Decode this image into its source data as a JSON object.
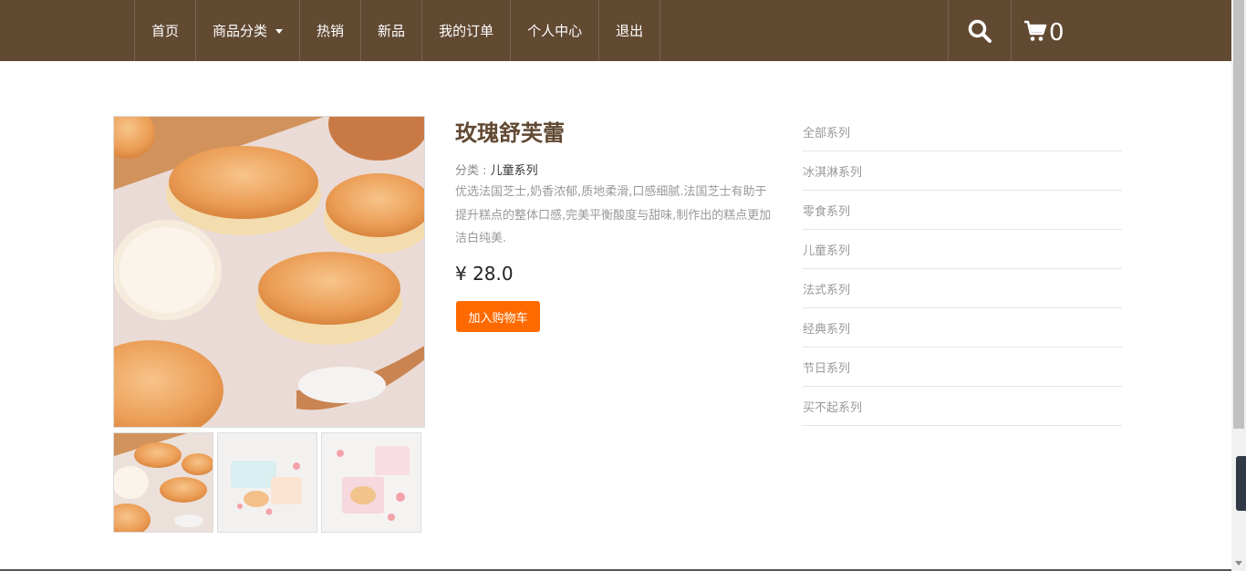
{
  "nav": {
    "items": [
      {
        "label": "首页"
      },
      {
        "label": "商品分类"
      },
      {
        "label": "热销"
      },
      {
        "label": "新品"
      },
      {
        "label": "我的订单"
      },
      {
        "label": "个人中心"
      },
      {
        "label": "退出"
      }
    ],
    "search_icon": "search-icon",
    "cart_icon": "cart-icon",
    "cart_count": "0"
  },
  "product": {
    "title": "玫瑰舒芙蕾",
    "category_label": "分类 : ",
    "category_value": "儿童系列",
    "description": "优选法国芝士,奶香浓郁,质地柔滑,口感细腻.法国芝士有助于提升糕点的整体口感,完美平衡酸度与甜味,制作出的糕点更加洁白纯美.",
    "price": "¥ 28.0",
    "add_to_cart_label": "加入购物车"
  },
  "sidebar": {
    "items": [
      {
        "label": "全部系列"
      },
      {
        "label": "冰淇淋系列"
      },
      {
        "label": "零食系列"
      },
      {
        "label": "儿童系列"
      },
      {
        "label": "法式系列"
      },
      {
        "label": "经典系列"
      },
      {
        "label": "节日系列"
      },
      {
        "label": "买不起系列"
      }
    ]
  },
  "colors": {
    "header": "#614932",
    "accent": "#ff6a00",
    "title": "#614932"
  }
}
